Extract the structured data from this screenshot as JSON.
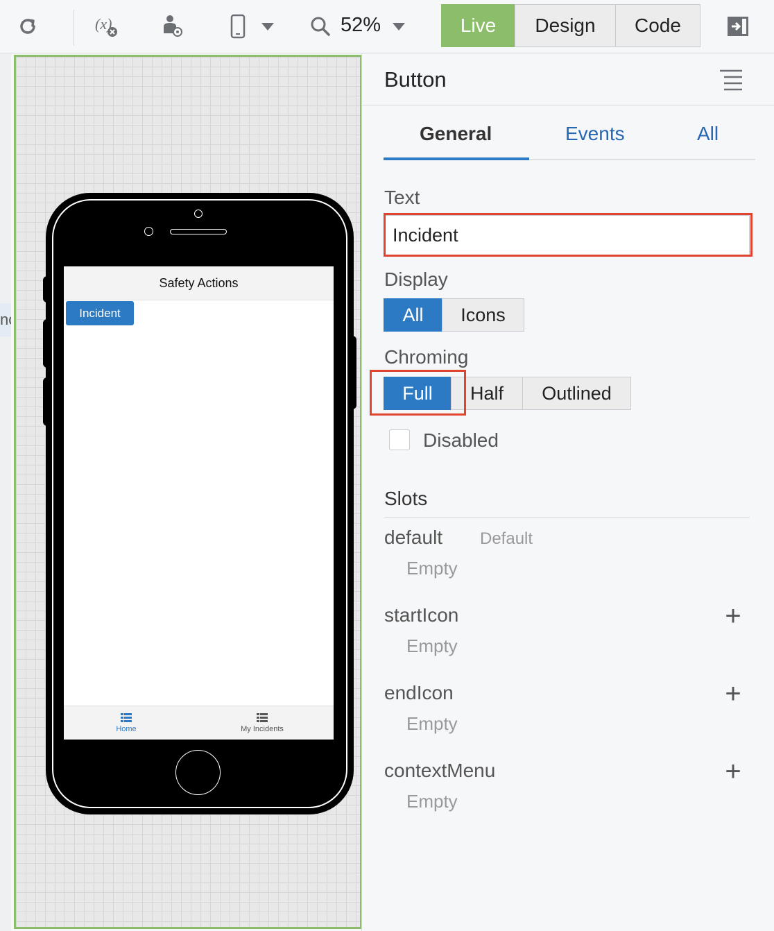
{
  "toolbar": {
    "zoom": "52%",
    "modes": [
      "Live",
      "Design",
      "Code"
    ],
    "active_mode": "Live",
    "icons": [
      "refresh-icon",
      "variable-icon",
      "user-icon",
      "device-icon",
      "search-icon",
      "dock-panel-icon"
    ]
  },
  "canvas": {
    "left_fragment": "nc"
  },
  "phone": {
    "title": "Safety Actions",
    "button_label": "Incident",
    "tabs": [
      "Home",
      "My Incidents"
    ]
  },
  "panel": {
    "title": "Button",
    "tabs": [
      "General",
      "Events",
      "All"
    ],
    "active_tab": "General",
    "text_label": "Text",
    "text_value": "Incident",
    "display_label": "Display",
    "display_options": [
      "All",
      "Icons"
    ],
    "display_selected": "All",
    "chroming_label": "Chroming",
    "chroming_options": [
      "Full",
      "Half",
      "Outlined"
    ],
    "chroming_selected": "Full",
    "disabled_label": "Disabled",
    "disabled_checked": false,
    "slots_title": "Slots",
    "default_slot_name": "default",
    "default_slot_badge": "Default",
    "empty_text": "Empty",
    "slot_names": [
      "startIcon",
      "endIcon",
      "contextMenu"
    ]
  },
  "colors": {
    "accent_blue": "#2d7ac4",
    "live_green": "#8cbd6a",
    "highlight_red": "#e0432f"
  }
}
